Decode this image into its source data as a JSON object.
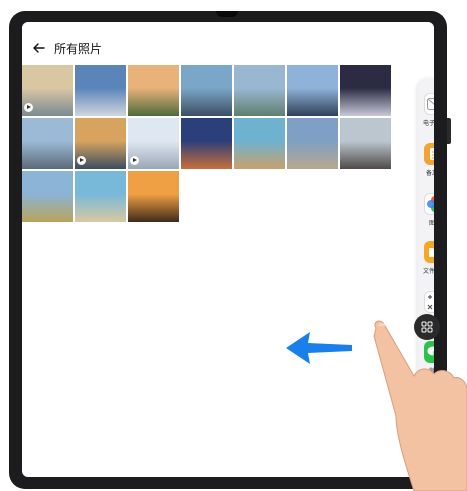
{
  "title": "所有照片",
  "photos": [
    {
      "name": "beach-surfer",
      "colors": [
        "#d9c7a4",
        "#7a8a90"
      ],
      "video": true
    },
    {
      "name": "castle",
      "colors": [
        "#5b85b9",
        "#cfd6de"
      ],
      "video": false
    },
    {
      "name": "balloons-field",
      "colors": [
        "#e8b27a",
        "#4e6b3a"
      ],
      "video": false
    },
    {
      "name": "mountain-lake",
      "colors": [
        "#7aa6c8",
        "#3c4f63"
      ],
      "video": false
    },
    {
      "name": "lake-village",
      "colors": [
        "#9ab7d2",
        "#5f7f6d"
      ],
      "video": false
    },
    {
      "name": "city-skyline",
      "colors": [
        "#8fb2d9",
        "#2f4159"
      ],
      "video": false
    },
    {
      "name": "fireworks-city",
      "colors": [
        "#2b2b44",
        "#c8c8d8"
      ],
      "video": false
    },
    {
      "name": "bridge-city",
      "colors": [
        "#9bbad6",
        "#5c6a78"
      ],
      "video": false
    },
    {
      "name": "coast-sunset",
      "colors": [
        "#d7a35f",
        "#3a4d60"
      ],
      "video": true
    },
    {
      "name": "snow-ski",
      "colors": [
        "#dfe8f2",
        "#9aa6b5"
      ],
      "video": true
    },
    {
      "name": "ferris-wheel",
      "colors": [
        "#2b3f7a",
        "#c96f3a"
      ],
      "video": false
    },
    {
      "name": "beach-umbrella",
      "colors": [
        "#6eb2d0",
        "#c9a06b"
      ],
      "video": false
    },
    {
      "name": "palace",
      "colors": [
        "#7f9fc4",
        "#b8a98e"
      ],
      "video": false
    },
    {
      "name": "snow-mountain",
      "colors": [
        "#bcc6cf",
        "#4f4a48"
      ],
      "video": false
    },
    {
      "name": "meadow-lake",
      "colors": [
        "#8cb4d6",
        "#b9a35a"
      ],
      "video": false
    },
    {
      "name": "sea-cliff",
      "colors": [
        "#78b8d8",
        "#d9c8a2"
      ],
      "video": false
    },
    {
      "name": "palm-sunset",
      "colors": [
        "#f0a044",
        "#402a1a"
      ],
      "video": false
    }
  ],
  "dock": [
    {
      "label": "电子邮件",
      "icon": "mail-icon",
      "color": "#ffffff"
    },
    {
      "label": "备忘录",
      "icon": "notes-icon",
      "color": "#f4a233"
    },
    {
      "label": "图库",
      "icon": "gallery-icon",
      "color": "#ffffff"
    },
    {
      "label": "文件管理",
      "icon": "files-icon",
      "color": "#f5a623"
    },
    {
      "label": "计算器",
      "icon": "calculator-icon",
      "color": "#ffffff"
    },
    {
      "label": "微信",
      "icon": "wechat-icon",
      "color": "#2bc24c"
    }
  ],
  "accent": "#1a7fe8"
}
